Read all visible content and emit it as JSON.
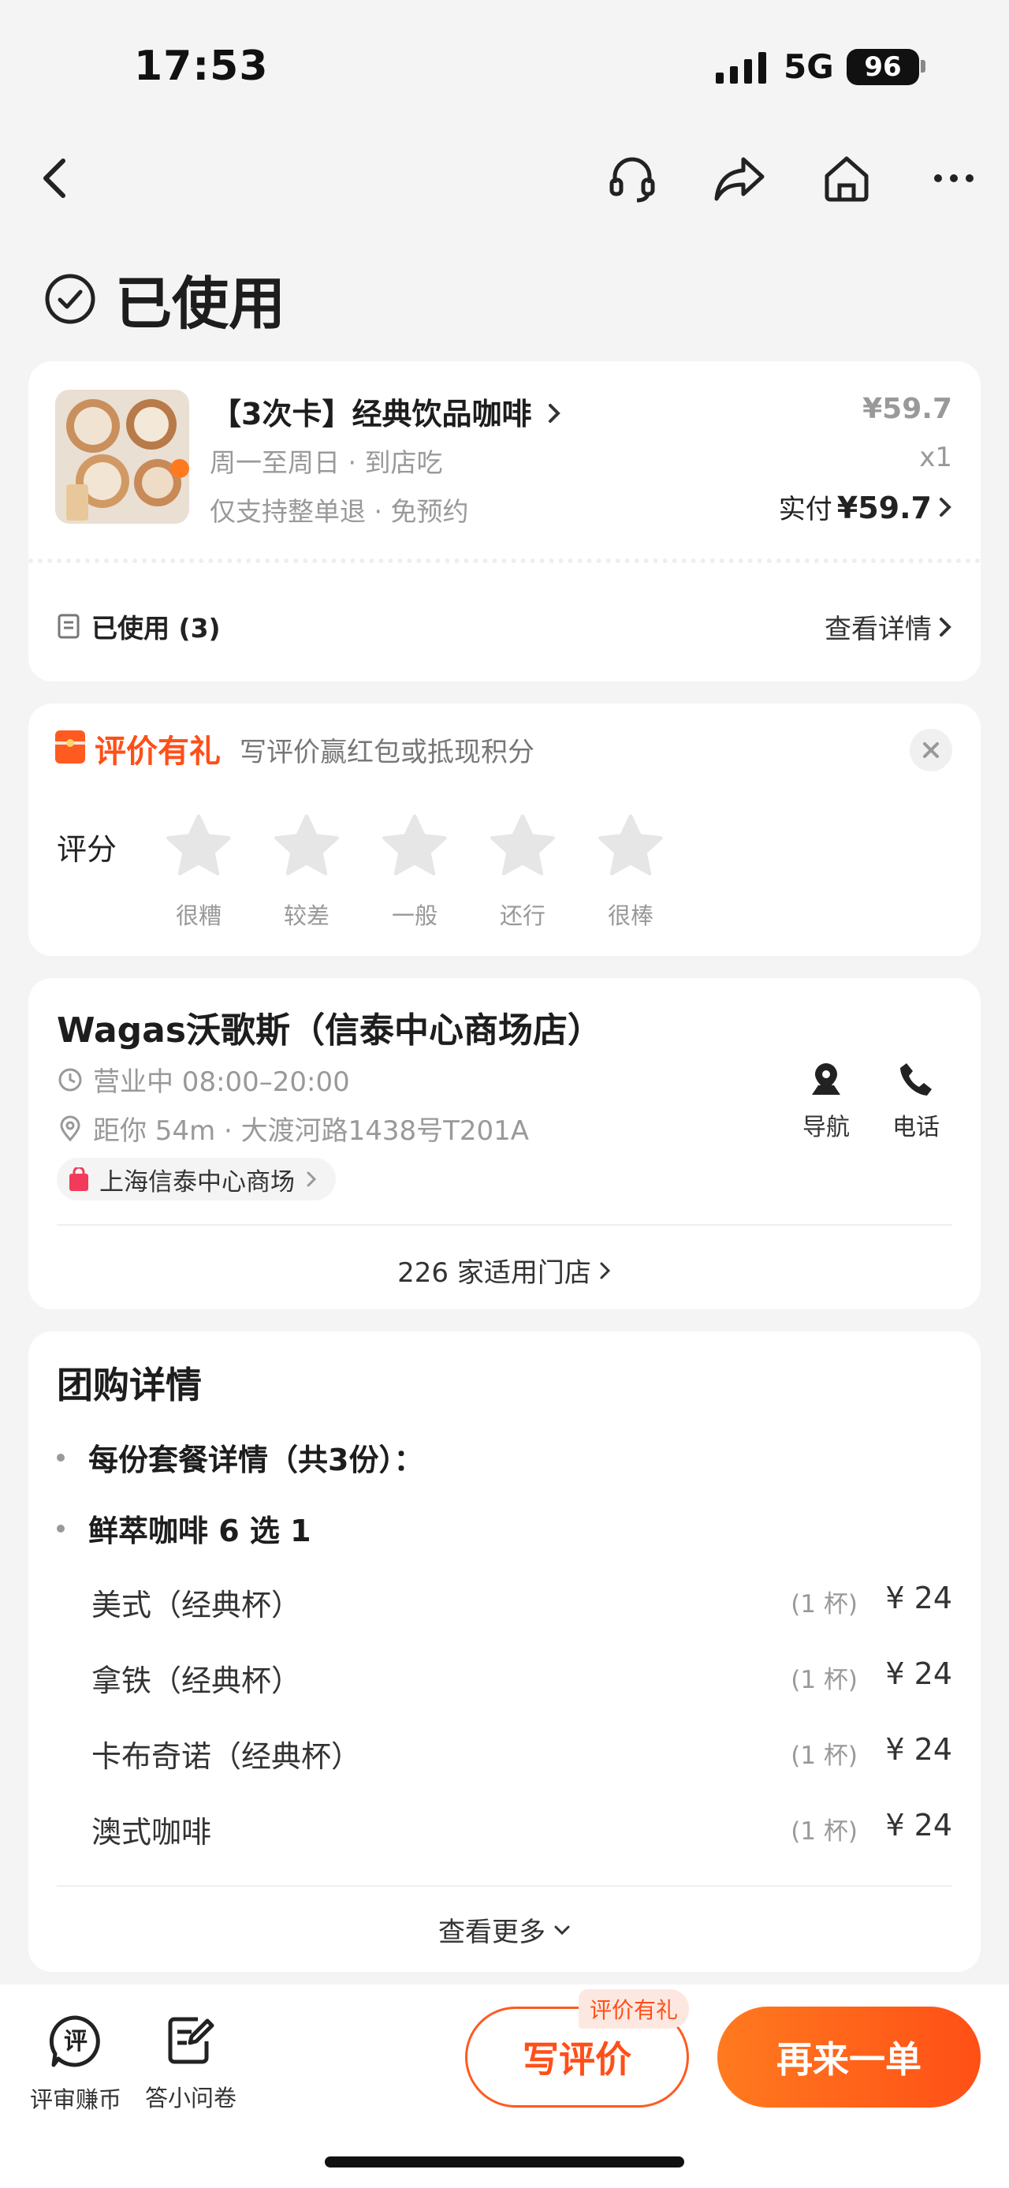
{
  "status_bar": {
    "time": "17:53",
    "network": "5G",
    "battery": "96"
  },
  "header": {
    "status_title": "已使用"
  },
  "order": {
    "product_name": "【3次卡】经典饮品咖啡",
    "schedule": "周一至周日 · 到店吃",
    "policy": "仅支持整单退 · 免预约",
    "price": "¥59.7",
    "qty": "x1",
    "paid_label": "实付",
    "paid_amount": "¥59.7",
    "used_label": "已使用 (3)",
    "detail_link": "查看详情"
  },
  "review": {
    "title": "评价有礼",
    "subtitle": "写评价赢红包或抵现积分",
    "rating_label": "评分",
    "stars": [
      "很糟",
      "较差",
      "一般",
      "还行",
      "很棒"
    ],
    "rating_value": 0
  },
  "store": {
    "name": "Wagas沃歌斯（信泰中心商场店）",
    "hours": "营业中 08:00–20:00",
    "address": "距你 54m · 大渡河路1438号T201A",
    "mall": "上海信泰中心商场",
    "nav_label": "导航",
    "phone_label": "电话",
    "stores_link": "226 家适用门店"
  },
  "group": {
    "title": "团购详情",
    "line1": "每份套餐详情（共3份）：",
    "line2": "鲜萃咖啡 6 选 1",
    "items": [
      {
        "name": "美式（经典杯）",
        "count": "(1 杯)",
        "price": "¥ 24"
      },
      {
        "name": "拿铁（经典杯）",
        "count": "(1 杯)",
        "price": "¥ 24"
      },
      {
        "name": "卡布奇诺（经典杯）",
        "count": "(1 杯)",
        "price": "¥ 24"
      },
      {
        "name": "澳式咖啡",
        "count": "(1 杯)",
        "price": "¥ 24"
      }
    ],
    "more": "查看更多"
  },
  "bottom": {
    "review_coin": "评审赚币",
    "review_icon_char": "评",
    "survey": "答小问卷",
    "write_review": "写评价",
    "write_badge": "评价有礼",
    "order_again": "再来一单"
  },
  "colors": {
    "accent": "#ff4f19",
    "star_inactive": "#e6e6e6"
  }
}
